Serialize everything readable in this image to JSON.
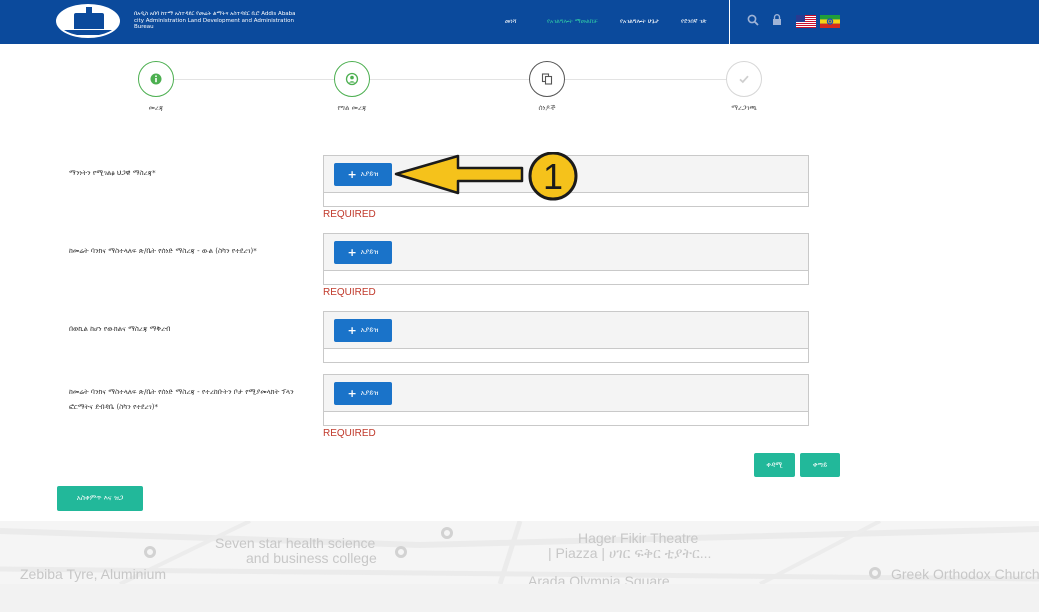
{
  "header": {
    "org_name": "በአዲስ አበባ ከተማ አስተዳደር የመሬት ልማትና አስተዳደር ቢሮ Addis Ababa city Administration Land Development and Administration Bureau",
    "nav": [
      "መነሻ",
      "የአገልግሎት ማመልከቻ",
      "የአገልግሎት ሁኔታ",
      "የደንበኛ ገጽ"
    ]
  },
  "steps": [
    {
      "label": "መረጃ",
      "state": "done",
      "icon": "info-icon"
    },
    {
      "label": "የግል መረጃ",
      "state": "done",
      "icon": "user-icon"
    },
    {
      "label": "ሰነዶች",
      "state": "current",
      "icon": "documents-icon"
    },
    {
      "label": "ማረጋገጫ",
      "state": "todo",
      "icon": "check-icon"
    }
  ],
  "documents": [
    {
      "label": "ማንነትን የሚገልፅ ህጋዊ ማስረጃ*",
      "button": "አያይዝ",
      "error": "REQUIRED"
    },
    {
      "label": "ከመሬት ባንክና ማስተላለፍ ጽ/ቤት የሰነድ ማስረጃ - ውል (ስካን የተደረገ)*",
      "button": "አያይዝ",
      "error": "REQUIRED"
    },
    {
      "label": "በወኪል ከሆነ የውክልና ማስረጃ ማቅረብ",
      "button": "አያይዝ",
      "error": ""
    },
    {
      "label": "ከመሬት ባንክና ማስተላለፍ ጽ/ቤት የሰነድ ማስረጃ - የተረከቡትን ቦታ የሚያመላክት ፕላን ፎርማትና ደብዳቤ (ስካን የተደረገ)*",
      "button": "አያይዝ",
      "error": "REQUIRED"
    }
  ],
  "annotation": {
    "number": "1"
  },
  "buttons": {
    "previous": "ቀዳሚ",
    "next": "ቀጣይ",
    "save_draft": "አስቀምጥ እና ዝጋ"
  },
  "map": {
    "labels": [
      "Seven star health science",
      "and business college",
      "Hager Fikir Theatre",
      "| Piazza | ሀገር ፍቅር ቲያትር...",
      "Zebiba Tyre, Aluminium",
      "Greek Orthodox Church",
      "Arada Olympia Square"
    ]
  },
  "colors": {
    "header": "#0b4a9c",
    "primary": "#1a73c9",
    "accent": "#22b89a",
    "error": "#c0392b",
    "annotation": "#f5c21b"
  }
}
